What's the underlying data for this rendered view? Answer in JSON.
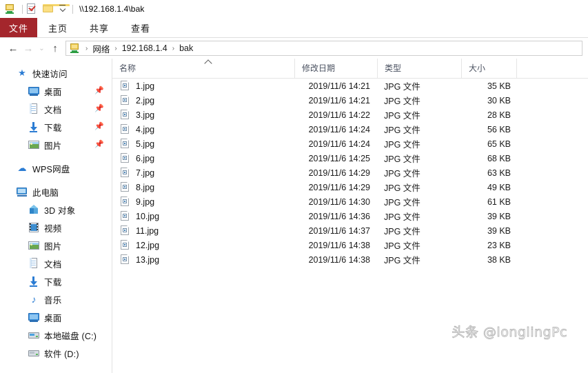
{
  "window": {
    "title": "\\\\192.168.1.4\\bak",
    "quick_access": [
      {
        "name": "network-computer-icon",
        "label": "属性"
      },
      {
        "name": "properties-icon",
        "label": "属性"
      },
      {
        "name": "new-folder-icon",
        "label": "新建文件夹"
      },
      {
        "name": "customize-quick-access-icon",
        "label": "自定义快速访问工具栏"
      }
    ]
  },
  "ribbon": {
    "file_tab": "文件",
    "file_tab_color": "#a4262c",
    "tabs": [
      "主页",
      "共享",
      "查看"
    ]
  },
  "address_bar": {
    "back": "←",
    "forward": "→",
    "recent": "⌄",
    "up": "↑",
    "location_icon": "network-computer-icon",
    "breadcrumb": [
      "网络",
      "192.168.1.4",
      "bak"
    ],
    "separator": "›"
  },
  "sidebar": {
    "groups": [
      {
        "header": {
          "label": "快速访问",
          "icon": "star-icon"
        },
        "items": [
          {
            "label": "桌面",
            "icon": "monitor-icon",
            "pinned": true
          },
          {
            "label": "文档",
            "icon": "document-icon",
            "pinned": true
          },
          {
            "label": "下载",
            "icon": "download-icon",
            "pinned": true
          },
          {
            "label": "图片",
            "icon": "pictures-icon",
            "pinned": true
          }
        ]
      },
      {
        "header": {
          "label": "WPS网盘",
          "icon": "cloud-icon"
        },
        "items": []
      },
      {
        "header": {
          "label": "此电脑",
          "icon": "this-pc-icon"
        },
        "items": [
          {
            "label": "3D 对象",
            "icon": "3d-objects-icon",
            "pinned": false
          },
          {
            "label": "视频",
            "icon": "videos-icon",
            "pinned": false
          },
          {
            "label": "图片",
            "icon": "pictures-icon",
            "pinned": false
          },
          {
            "label": "文档",
            "icon": "document-icon",
            "pinned": false
          },
          {
            "label": "下载",
            "icon": "download-icon",
            "pinned": false
          },
          {
            "label": "音乐",
            "icon": "music-icon",
            "pinned": false
          },
          {
            "label": "桌面",
            "icon": "monitor-icon",
            "pinned": false
          },
          {
            "label": "本地磁盘 (C:)",
            "icon": "system-drive-icon",
            "pinned": false
          },
          {
            "label": "软件 (D:)",
            "icon": "drive-icon",
            "pinned": false
          }
        ]
      }
    ],
    "pin_glyph": "📌"
  },
  "file_list": {
    "columns": {
      "name": "名称",
      "date": "修改日期",
      "type": "类型",
      "size": "大小"
    },
    "sort": {
      "column": "名称",
      "direction": "ascending"
    },
    "rows": [
      {
        "name": "1.jpg",
        "date": "2019/11/6 14:21",
        "type": "JPG 文件",
        "size": "35 KB"
      },
      {
        "name": "2.jpg",
        "date": "2019/11/6 14:21",
        "type": "JPG 文件",
        "size": "30 KB"
      },
      {
        "name": "3.jpg",
        "date": "2019/11/6 14:22",
        "type": "JPG 文件",
        "size": "28 KB"
      },
      {
        "name": "4.jpg",
        "date": "2019/11/6 14:24",
        "type": "JPG 文件",
        "size": "56 KB"
      },
      {
        "name": "5.jpg",
        "date": "2019/11/6 14:24",
        "type": "JPG 文件",
        "size": "65 KB"
      },
      {
        "name": "6.jpg",
        "date": "2019/11/6 14:25",
        "type": "JPG 文件",
        "size": "68 KB"
      },
      {
        "name": "7.jpg",
        "date": "2019/11/6 14:29",
        "type": "JPG 文件",
        "size": "63 KB"
      },
      {
        "name": "8.jpg",
        "date": "2019/11/6 14:29",
        "type": "JPG 文件",
        "size": "49 KB"
      },
      {
        "name": "9.jpg",
        "date": "2019/11/6 14:30",
        "type": "JPG 文件",
        "size": "61 KB"
      },
      {
        "name": "10.jpg",
        "date": "2019/11/6 14:36",
        "type": "JPG 文件",
        "size": "39 KB"
      },
      {
        "name": "11.jpg",
        "date": "2019/11/6 14:37",
        "type": "JPG 文件",
        "size": "39 KB"
      },
      {
        "name": "12.jpg",
        "date": "2019/11/6 14:38",
        "type": "JPG 文件",
        "size": "23 KB"
      },
      {
        "name": "13.jpg",
        "date": "2019/11/6 14:38",
        "type": "JPG 文件",
        "size": "38 KB"
      }
    ]
  },
  "watermark": "头条 @longlingPc"
}
